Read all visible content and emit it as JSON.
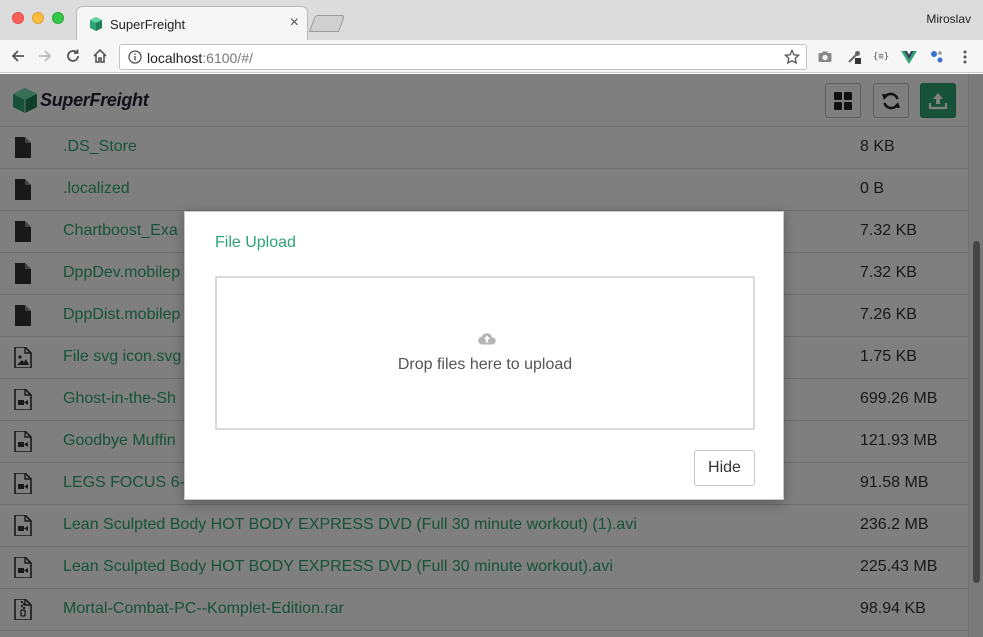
{
  "browser": {
    "tab_title": "SuperFreight",
    "profile": "Miroslav",
    "url_host": "localhost",
    "url_rest": ":6100/#/"
  },
  "app": {
    "logo_text": "SuperFreight",
    "brand_color": "#2da574",
    "header_buttons": [
      "grid-view",
      "refresh",
      "upload"
    ]
  },
  "files": [
    {
      "name": ".DS_Store",
      "size": "8 KB",
      "type": "file"
    },
    {
      "name": ".localized",
      "size": "0 B",
      "type": "file"
    },
    {
      "name": "Chartboost_Exa",
      "size": "7.32 KB",
      "type": "file"
    },
    {
      "name": "DppDev.mobilep",
      "size": "7.32 KB",
      "type": "file"
    },
    {
      "name": "DppDist.mobilep",
      "size": "7.26 KB",
      "type": "file"
    },
    {
      "name": "File svg icon.svg",
      "size": "1.75 KB",
      "type": "image"
    },
    {
      "name": "Ghost-in-the-Sh",
      "size": "699.26 MB",
      "type": "video"
    },
    {
      "name": "Goodbye Muffin",
      "size": "121.93 MB",
      "type": "video"
    },
    {
      "name": "LEGS FOCUS 6-",
      "size": "91.58 MB",
      "type": "video"
    },
    {
      "name": "Lean Sculpted Body HOT BODY EXPRESS DVD (Full 30 minute workout) (1).avi",
      "size": "236.2 MB",
      "type": "video"
    },
    {
      "name": "Lean Sculpted Body HOT BODY EXPRESS DVD (Full 30 minute workout).avi",
      "size": "225.43 MB",
      "type": "video"
    },
    {
      "name": "Mortal-Combat-PC--Komplet-Edition.rar",
      "size": "98.94 KB",
      "type": "archive"
    }
  ],
  "modal": {
    "title": "File Upload",
    "dropzone_text": "Drop files here to upload",
    "hide_label": "Hide"
  }
}
